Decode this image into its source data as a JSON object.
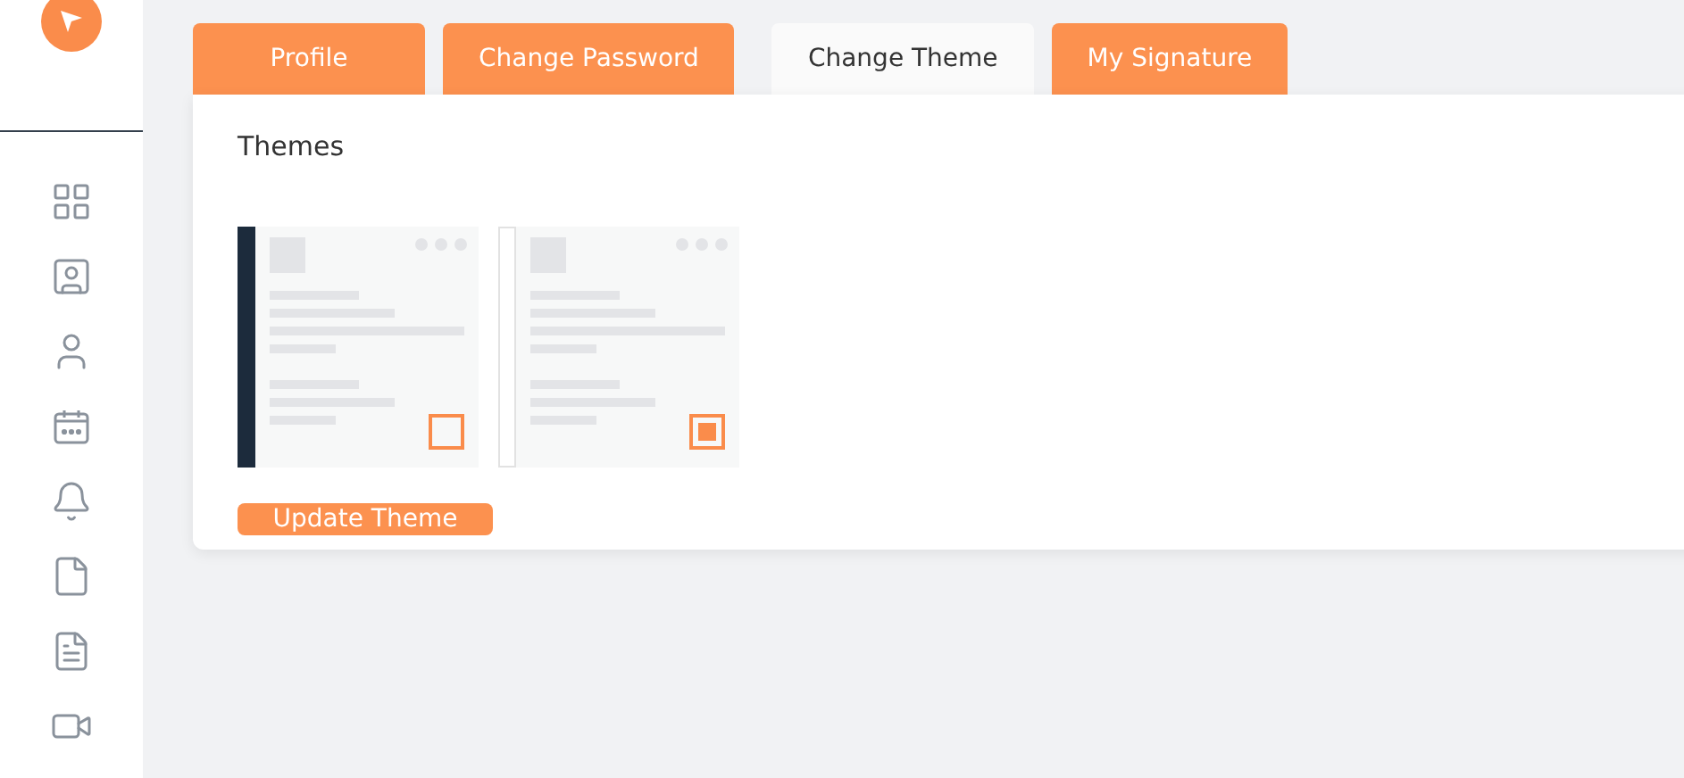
{
  "tabs": [
    {
      "label": "Profile",
      "selected": false
    },
    {
      "label": "Change Password",
      "selected": false
    },
    {
      "label": "Change Theme",
      "selected": true
    },
    {
      "label": "My Signature",
      "selected": false
    }
  ],
  "panel": {
    "title": "Themes",
    "themes": [
      {
        "kind": "dark",
        "selected": false
      },
      {
        "kind": "light",
        "selected": true
      }
    ],
    "button": "Update Theme"
  }
}
